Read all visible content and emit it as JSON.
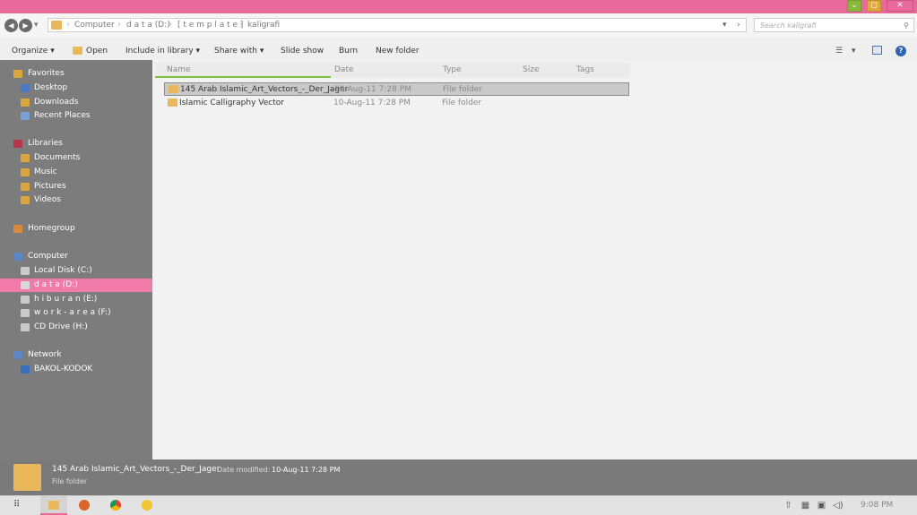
{
  "window": {
    "minimize_glyph": "⌄",
    "maximize_glyph": "◻",
    "close_glyph": "✕",
    "colors": {
      "titlebar": "#e8699a",
      "minimize": "#8ab83a",
      "maximize": "#e1a93b",
      "close": "#e8699a",
      "accent_selection": "#f07aa8"
    }
  },
  "address_bar": {
    "crumbs": [
      "Computer",
      "d a t a (D:)",
      "[ t e m p l a t e ]",
      "kaligrafi"
    ],
    "search_placeholder": "Search kaligrafi",
    "dropdown_glyph": "▾",
    "refresh_glyph": "›"
  },
  "toolbar": {
    "organize": "Organize",
    "open": "Open",
    "include_in_library": "Include in library",
    "share_with": "Share with",
    "slide_show": "Slide show",
    "burn": "Burn",
    "new_folder": "New folder",
    "dropdown_glyph": "▾",
    "help_glyph": "?"
  },
  "sidebar": {
    "favorites": {
      "label": "Favorites",
      "items": [
        "Desktop",
        "Downloads",
        "Recent Places"
      ]
    },
    "libraries": {
      "label": "Libraries",
      "items": [
        "Documents",
        "Music",
        "Pictures",
        "Videos"
      ]
    },
    "homegroup": {
      "label": "Homegroup"
    },
    "computer": {
      "label": "Computer",
      "items": [
        "Local Disk (C:)",
        "d a t a (D:)",
        "h i b u r a n (E:)",
        "w o r k - a r e a (F:)",
        "CD Drive (H:)"
      ]
    },
    "network": {
      "label": "Network",
      "items": [
        "BAKOL-KODOK"
      ]
    }
  },
  "columns": {
    "name": "Name",
    "date": "Date",
    "type": "Type",
    "size": "Size",
    "tags": "Tags"
  },
  "files": [
    {
      "name": "145 Arab Islamic_Art_Vectors_-_Der_Jager",
      "date": "10-Aug-11 7:28 PM",
      "type": "File folder"
    },
    {
      "name": "Islamic Calligraphy Vector",
      "date": "10-Aug-11 7:28 PM",
      "type": "File folder"
    }
  ],
  "details": {
    "name": "145 Arab Islamic_Art_Vectors_-_Der_Jager",
    "date_label": "Date modified:",
    "date_value": "10-Aug-11 7:28 PM",
    "type": "File folder"
  },
  "taskbar": {
    "start_glyph": "⠿",
    "clock": "9:08 PM"
  }
}
